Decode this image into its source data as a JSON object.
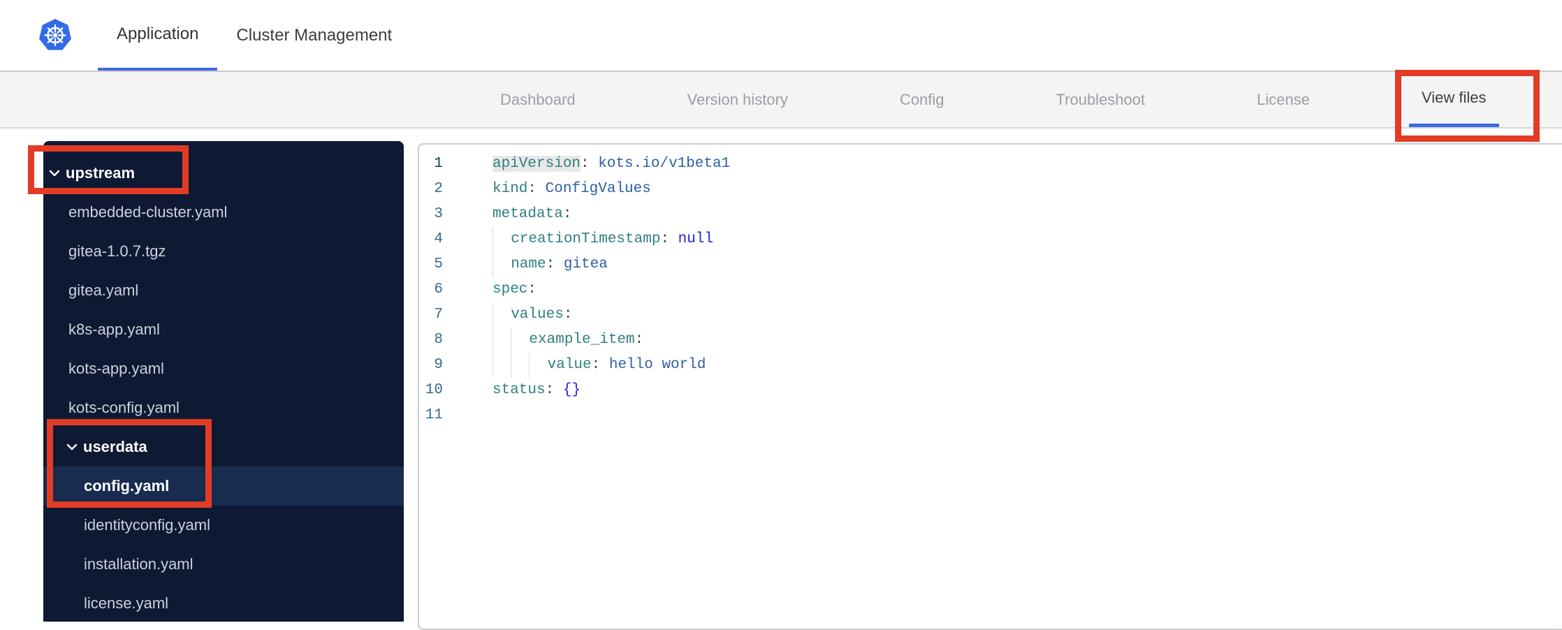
{
  "header": {
    "tabs": [
      {
        "label": "Application",
        "active": true
      },
      {
        "label": "Cluster Management",
        "active": false
      }
    ]
  },
  "nav": {
    "tabs": [
      {
        "label": "Dashboard",
        "active": false,
        "annotated": false
      },
      {
        "label": "Version history",
        "active": false,
        "annotated": false
      },
      {
        "label": "Config",
        "active": false,
        "annotated": false
      },
      {
        "label": "Troubleshoot",
        "active": false,
        "annotated": false
      },
      {
        "label": "License",
        "active": false,
        "annotated": false
      },
      {
        "label": "View files",
        "active": true,
        "annotated": true
      }
    ]
  },
  "file_tree": {
    "items": [
      {
        "label": "upstream",
        "type": "folder",
        "depth": 0,
        "expanded": true,
        "selected": false,
        "annotated": true
      },
      {
        "label": "embedded-cluster.yaml",
        "type": "file",
        "depth": 1,
        "selected": false
      },
      {
        "label": "gitea-1.0.7.tgz",
        "type": "file",
        "depth": 1,
        "selected": false
      },
      {
        "label": "gitea.yaml",
        "type": "file",
        "depth": 1,
        "selected": false
      },
      {
        "label": "k8s-app.yaml",
        "type": "file",
        "depth": 1,
        "selected": false
      },
      {
        "label": "kots-app.yaml",
        "type": "file",
        "depth": 1,
        "selected": false
      },
      {
        "label": "kots-config.yaml",
        "type": "file",
        "depth": 1,
        "selected": false
      },
      {
        "label": "userdata",
        "type": "folder",
        "depth": 1,
        "expanded": true,
        "selected": false,
        "annotated": true
      },
      {
        "label": "config.yaml",
        "type": "file",
        "depth": 2,
        "selected": true
      },
      {
        "label": "identityconfig.yaml",
        "type": "file",
        "depth": 2,
        "selected": false
      },
      {
        "label": "installation.yaml",
        "type": "file",
        "depth": 2,
        "selected": false
      },
      {
        "label": "license.yaml",
        "type": "file",
        "depth": 2,
        "selected": false
      }
    ]
  },
  "editor": {
    "language": "yaml",
    "lines": [
      {
        "num": 1,
        "active": true,
        "indent": 0,
        "tokens": [
          {
            "t": "key",
            "v": "apiVersion",
            "hl": true
          },
          {
            "t": "punc",
            "v": ":"
          },
          {
            "t": "plain",
            "v": " "
          },
          {
            "t": "val",
            "v": "kots.io/v1beta1"
          }
        ]
      },
      {
        "num": 2,
        "active": false,
        "indent": 0,
        "tokens": [
          {
            "t": "key",
            "v": "kind"
          },
          {
            "t": "punc",
            "v": ":"
          },
          {
            "t": "plain",
            "v": " "
          },
          {
            "t": "val",
            "v": "ConfigValues"
          }
        ]
      },
      {
        "num": 3,
        "active": false,
        "indent": 0,
        "tokens": [
          {
            "t": "key",
            "v": "metadata"
          },
          {
            "t": "punc",
            "v": ":"
          }
        ]
      },
      {
        "num": 4,
        "active": false,
        "indent": 1,
        "tokens": [
          {
            "t": "key",
            "v": "creationTimestamp"
          },
          {
            "t": "punc",
            "v": ":"
          },
          {
            "t": "plain",
            "v": " "
          },
          {
            "t": "const",
            "v": "null"
          }
        ]
      },
      {
        "num": 5,
        "active": false,
        "indent": 1,
        "tokens": [
          {
            "t": "key",
            "v": "name"
          },
          {
            "t": "punc",
            "v": ":"
          },
          {
            "t": "plain",
            "v": " "
          },
          {
            "t": "val",
            "v": "gitea"
          }
        ]
      },
      {
        "num": 6,
        "active": false,
        "indent": 0,
        "tokens": [
          {
            "t": "key",
            "v": "spec"
          },
          {
            "t": "punc",
            "v": ":"
          }
        ]
      },
      {
        "num": 7,
        "active": false,
        "indent": 1,
        "tokens": [
          {
            "t": "key",
            "v": "values"
          },
          {
            "t": "punc",
            "v": ":"
          }
        ]
      },
      {
        "num": 8,
        "active": false,
        "indent": 2,
        "tokens": [
          {
            "t": "key",
            "v": "example_item"
          },
          {
            "t": "punc",
            "v": ":"
          }
        ]
      },
      {
        "num": 9,
        "active": false,
        "indent": 3,
        "tokens": [
          {
            "t": "key",
            "v": "value"
          },
          {
            "t": "punc",
            "v": ":"
          },
          {
            "t": "plain",
            "v": " "
          },
          {
            "t": "val",
            "v": "hello world"
          }
        ]
      },
      {
        "num": 10,
        "active": false,
        "indent": 0,
        "tokens": [
          {
            "t": "key",
            "v": "status"
          },
          {
            "t": "punc",
            "v": ":"
          },
          {
            "t": "plain",
            "v": " "
          },
          {
            "t": "const",
            "v": "{}"
          }
        ]
      },
      {
        "num": 11,
        "active": false,
        "indent": 0,
        "tokens": []
      }
    ]
  },
  "colors": {
    "accent_blue": "#3b6be2",
    "logo_blue": "#326ce5",
    "annotation_red": "#e23c26",
    "sidebar_bg": "#0e1a33",
    "sidebar_selected_bg": "#172c4e",
    "nav_bg": "#f4f4f5",
    "code_key": "#2f7f7f",
    "code_value": "#2d5fa6",
    "code_constant": "#2424cf",
    "line_number": "#366b8a"
  },
  "icons": {
    "logo": "kubernetes-logo",
    "folder_chevron": "chevron-down"
  }
}
